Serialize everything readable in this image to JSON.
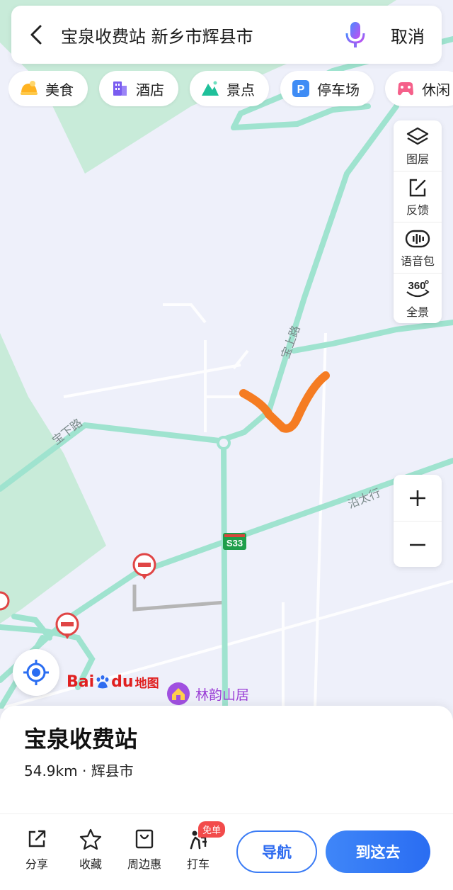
{
  "search": {
    "query": "宝泉收费站 新乡市辉县市",
    "cancel_label": "取消"
  },
  "categories": [
    {
      "label": "美食",
      "icon": "food-icon"
    },
    {
      "label": "酒店",
      "icon": "hotel-icon"
    },
    {
      "label": "景点",
      "icon": "scenic-icon"
    },
    {
      "label": "停车场",
      "icon": "parking-icon"
    },
    {
      "label": "休闲",
      "icon": "leisure-icon"
    }
  ],
  "map_tools": [
    {
      "label": "图层",
      "icon": "layers-icon"
    },
    {
      "label": "反馈",
      "icon": "feedback-icon"
    },
    {
      "label": "语音包",
      "icon": "voice-pack-icon"
    },
    {
      "label": "全景",
      "icon": "panorama-360-icon"
    }
  ],
  "map": {
    "road_labels": {
      "baoshang": "宝上路",
      "baoxia": "宝下路",
      "yantaixing": "沿太行",
      "highway_shield": "S33"
    },
    "poi_name": "林韵山居",
    "logo": "Baidu地图",
    "colors": {
      "road": "#9fe3cf",
      "route_highlight": "#f57c22",
      "green_area": "#c8ebd9",
      "highway_shield": "#1f9e4a"
    }
  },
  "place": {
    "title": "宝泉收费站",
    "distance": "54.9km",
    "separator": " · ",
    "city": "辉县市"
  },
  "actions": {
    "share": "分享",
    "favorite": "收藏",
    "nearby_deals": "周边惠",
    "taxi": "打车",
    "taxi_badge": "免单",
    "navigate": "导航",
    "go_here": "到这去"
  }
}
